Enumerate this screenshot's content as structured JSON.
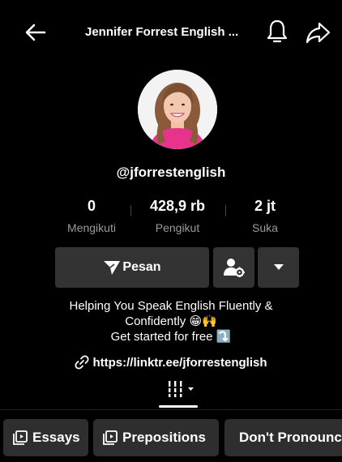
{
  "header": {
    "title": "Jennifer Forrest English ...",
    "back_icon": "back-arrow-icon",
    "bell_icon": "bell-icon",
    "share_icon": "share-icon"
  },
  "profile": {
    "username": "@jforrestenglish",
    "avatar": "profile-photo"
  },
  "stats": [
    {
      "value": "0",
      "label": "Mengikuti"
    },
    {
      "value": "428,9 rb",
      "label": "Pengikut"
    },
    {
      "value": "2 jt",
      "label": "Suka"
    }
  ],
  "actions": {
    "message_label": "Pesan",
    "friend_icon": "person-settings-icon",
    "more_icon": "caret-down-icon"
  },
  "bio": {
    "line1": "Helping You Speak English Fluently &",
    "line2": "Confidently 😁🙌",
    "line3": "Get started for free ⤵️"
  },
  "link": {
    "url": "https://linktr.ee/jforrestenglish"
  },
  "playlists": [
    {
      "label": "Essays"
    },
    {
      "label": "Prepositions"
    },
    {
      "label": "Don't Pronounce"
    }
  ],
  "colors": {
    "background": "#000000",
    "button": "#333333",
    "chip": "#2e2e2e",
    "muted_text": "#9a9a9a"
  }
}
